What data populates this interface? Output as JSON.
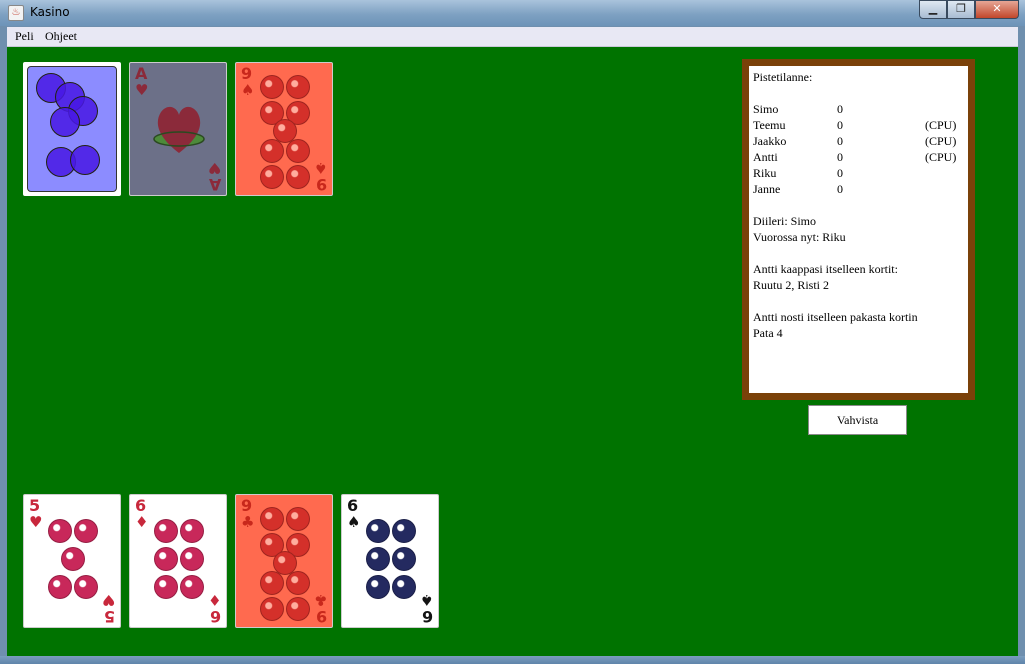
{
  "window": {
    "title": "Kasino",
    "icon": "java-cup-icon",
    "min_glyph": "▁",
    "max_glyph": "❐",
    "close_glyph": "✕"
  },
  "menu": [
    "Peli",
    "Ohjeet"
  ],
  "table_cards": [
    {
      "type": "back",
      "color": "#8c8cff"
    },
    {
      "type": "face",
      "rank": "A",
      "suit": "♥",
      "name": "ace-of-hearts",
      "bg": "#6c7088",
      "fg": "#8b2a3a"
    },
    {
      "type": "face",
      "rank": "9",
      "suit": "♠",
      "name": "nine-of-spades",
      "bg": "#ff6a4f",
      "fg": "#c8281c"
    }
  ],
  "hand_cards": [
    {
      "rank": "5",
      "suit": "♥",
      "name": "five-of-hearts",
      "bg": "#ffffff",
      "fg": "#c8283c"
    },
    {
      "rank": "6",
      "suit": "♦",
      "name": "six-of-diamonds",
      "bg": "#ffffff",
      "fg": "#c8283c"
    },
    {
      "rank": "9",
      "suit": "♣",
      "name": "nine-of-clubs",
      "bg": "#ff6a4f",
      "fg": "#c8281c"
    },
    {
      "rank": "6",
      "suit": "♠",
      "name": "six-of-spades",
      "bg": "#ffffff",
      "fg": "#141414"
    }
  ],
  "score": {
    "heading": "Pistetilanne:",
    "players": [
      {
        "name": "Simo",
        "points": "0",
        "cpu": ""
      },
      {
        "name": "Teemu",
        "points": "0",
        "cpu": "(CPU)"
      },
      {
        "name": "Jaakko",
        "points": "0",
        "cpu": "(CPU)"
      },
      {
        "name": "Antti",
        "points": "0",
        "cpu": "(CPU)"
      },
      {
        "name": "Riku",
        "points": "0",
        "cpu": ""
      },
      {
        "name": "Janne",
        "points": "0",
        "cpu": ""
      }
    ],
    "dealer": "Diileri: Simo",
    "turn": "Vuorossa nyt: Riku",
    "msg1": "Antti kaappasi itselleen kortit:",
    "msg2": "Ruutu 2, Risti 2",
    "msg3": "Antti nosti itselleen pakasta kortin",
    "msg4": "Pata 4"
  },
  "confirm_label": "Vahvista",
  "colors": {
    "felt": "#007300",
    "panel_border": "#7a4109",
    "bubble": "#4818e4"
  }
}
